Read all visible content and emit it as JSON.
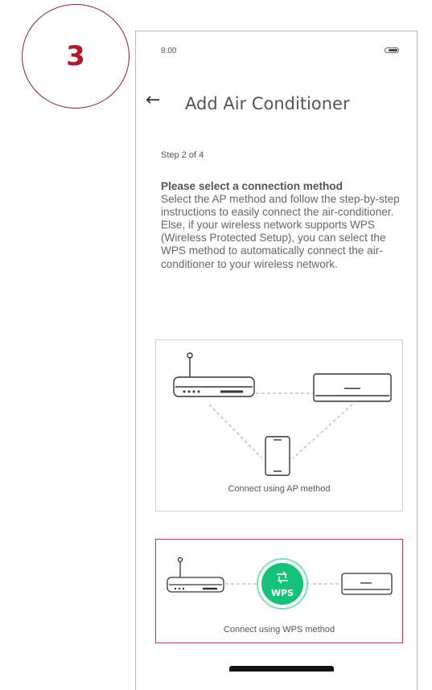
{
  "step_badge": {
    "number": "3"
  },
  "status_bar": {
    "time": "8:00"
  },
  "header": {
    "back_icon": "back-arrow-icon",
    "title": "Add Air Conditioner"
  },
  "step_indicator": "Step 2 of 4",
  "description": {
    "heading": "Please select a connection method",
    "body": "Select the AP method and follow the step-by-step instructions to easily connect the air-conditioner. Else, if your wireless network supports WPS (Wireless Protected Setup), you can select the WPS method to automatically connect the air-conditioner to your wireless network."
  },
  "options": {
    "ap": {
      "label": "Connect using AP method",
      "icons": [
        "router-icon",
        "air-conditioner-icon",
        "smartphone-icon"
      ]
    },
    "wps": {
      "label": "Connect using WPS method",
      "badge_text": "WPS",
      "icons": [
        "router-icon",
        "wps-icon",
        "air-conditioner-icon"
      ]
    }
  },
  "colors": {
    "accent_red": "#b0182b",
    "wps_green": "#16c27a",
    "selected_border": "#c4344a"
  }
}
